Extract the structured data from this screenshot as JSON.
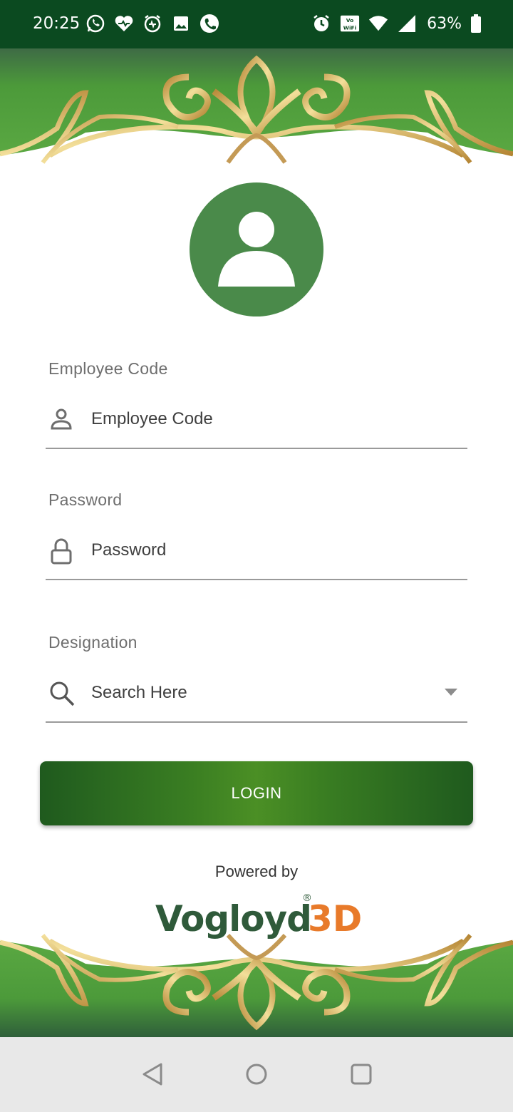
{
  "status_bar": {
    "time": "20:25",
    "left_icons": [
      "whatsapp-icon",
      "heart-icon",
      "alarm-app-icon",
      "gallery-icon",
      "phone-icon"
    ],
    "right_icons": [
      "alarm-icon",
      "vowifi-icon",
      "wifi-icon",
      "signal-icon"
    ],
    "battery": "63%"
  },
  "login_form": {
    "employee_code": {
      "label": "Employee Code",
      "placeholder": "Employee Code",
      "icon": "person-icon"
    },
    "password": {
      "label": "Password",
      "placeholder": "Password",
      "icon": "lock-icon"
    },
    "designation": {
      "label": "Designation",
      "placeholder": "Search Here",
      "icon": "search-icon"
    },
    "login_button": "LOGIN"
  },
  "footer": {
    "powered_by": "Powered by",
    "brand": {
      "name_part1": "Vogloyd",
      "name_part2": "3D",
      "registered": "®"
    }
  },
  "colors": {
    "status_bar": "#0b4a20",
    "brand_green": "#2f5a3a",
    "brand_orange": "#e87a2a",
    "avatar": "#4a8a4a",
    "button": "#3a7e22",
    "gold": "#d8b05a"
  },
  "nav_bar": [
    "back-icon",
    "home-icon",
    "recents-icon"
  ]
}
